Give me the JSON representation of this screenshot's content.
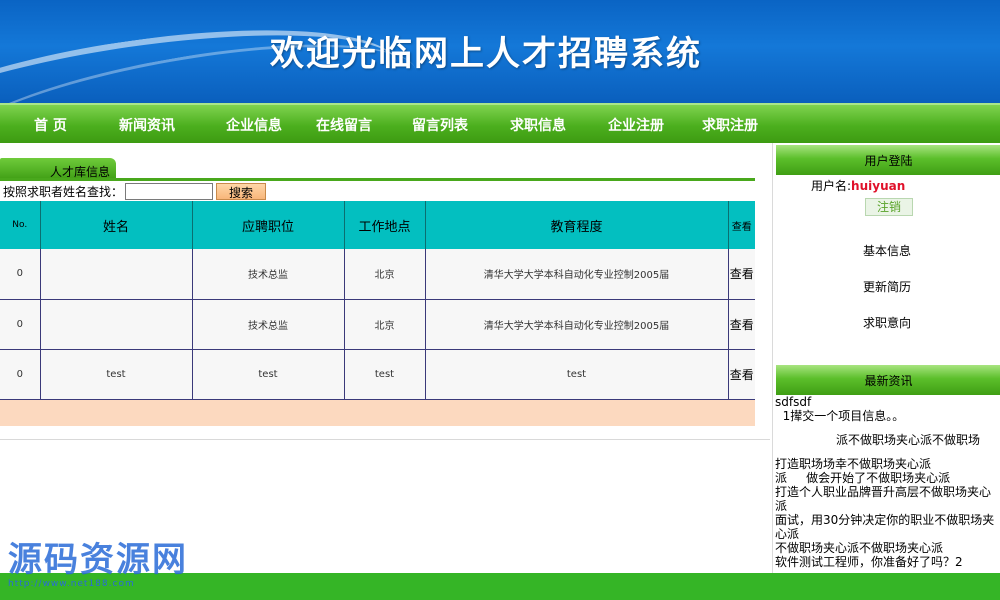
{
  "banner": {
    "title": "欢迎光临网上人才招聘系统"
  },
  "nav": {
    "items": [
      "首 页",
      "新闻资讯",
      "企业信息",
      "在线留言",
      "留言列表",
      "求职信息",
      "企业注册",
      "求职注册"
    ]
  },
  "main": {
    "tab_label": "人才库信息",
    "search_label": "按照求职者姓名查找：",
    "search_value": "",
    "search_button": "搜索",
    "table": {
      "headers": [
        "No.",
        "姓名",
        "应聘职位",
        "工作地点",
        "教育程度",
        "查看"
      ],
      "rows": [
        [
          "0",
          "",
          "技术总监",
          "北京",
          "清华大学大学本科自动化专业控制2005届",
          "查看"
        ],
        [
          "0",
          "",
          "技术总监",
          "北京",
          "清华大学大学本科自动化专业控制2005届",
          "查看"
        ],
        [
          "0",
          "test",
          "test",
          "test",
          "test",
          "查看"
        ]
      ]
    }
  },
  "sidebar": {
    "login_header": "用户登陆",
    "username_label": "用户名:",
    "username_value": "huiyuan",
    "logout_label": "注销",
    "links": [
      "基本信息",
      "更新简历",
      "求职意向"
    ],
    "news_header": "最新资讯",
    "news_items": [
      "sdfsdf",
      "  1撵交一个项目信息。。",
      "",
      "                派不做职场夹心派不做职场",
      "",
      "打造职场场幸不做职场夹心派",
      "派     做会开始了不做职场夹心派",
      "打造个人职业品牌晋升高层不做职场夹心派",
      "面试，用30分钟决定你的职业不做职场夹心派",
      "不做职场夹心派不做职场夹心派",
      "软件测试工程师，你准备好了吗？2"
    ]
  },
  "watermark": {
    "text": "源码资源网",
    "url": "http://www.net188.com"
  },
  "colors": {
    "banner_blue": "#0a64c4",
    "nav_green": "#4caf1e",
    "table_header": "#03bfc0",
    "accent_red": "#e0112a",
    "footer_green": "#35b526"
  }
}
